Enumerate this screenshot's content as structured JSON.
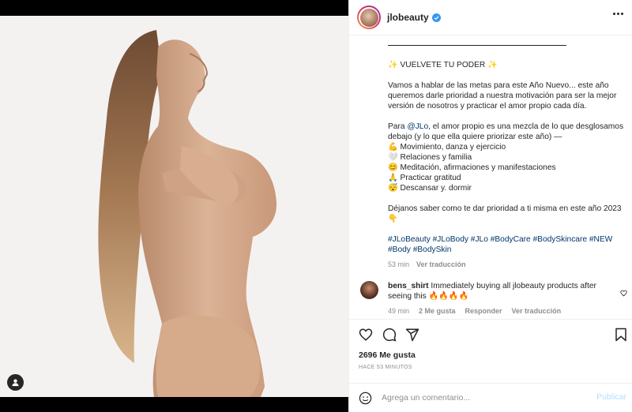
{
  "post": {
    "username": "jlobeauty",
    "image_alt": ""
  },
  "caption": {
    "title": "✨ VUELVETE TU PODER ✨",
    "para1": "Vamos a hablar de las metas para este Año Nuevo... este año queremos darle prioridad a nuestra motivación para ser la mejor versión de nosotros y practicar el amor propio cada día.",
    "para2_prefix": "Para ",
    "para2_mention": "@JLo",
    "para2_rest": ", el amor propio es una mezcla de lo que desglosamos debajo (y lo que ella quiere priorizar este año) —",
    "list": [
      {
        "emoji": "💪",
        "text": "Movimiento, danza y ejercicio"
      },
      {
        "emoji": "🤍",
        "text": "Relaciones y familia"
      },
      {
        "emoji": "😊",
        "text": "Meditación, afirmaciones y manifestaciones"
      },
      {
        "emoji": "🙏",
        "text": "Practicar gratitud"
      },
      {
        "emoji": "😴",
        "text": "Descansar y. dormir"
      }
    ],
    "para3": "Déjanos saber como te dar prioridad a ti misma en este año 2023 👇",
    "hashtags_line1": "#JLoBeauty #JLoBody #JLo #BodyCare #BodySkincare #NEW",
    "hashtags_line2": "#Body #BodySkin",
    "time": "53 min",
    "translate": "Ver traducción"
  },
  "comment": {
    "username": "bens_shirt",
    "text": "Immediately buying all jlobeauty products after seeing this 🔥🔥🔥🔥",
    "time": "49 min",
    "likes": "2 Me gusta",
    "reply": "Responder",
    "translate": "Ver traducción"
  },
  "stats": {
    "likes": "2696 Me gusta",
    "ago": "HACE 53 MINUTOS"
  },
  "add_comment": {
    "placeholder": "Agrega un comentario...",
    "publish": "Publicar"
  },
  "colors": {
    "link": "#00376b",
    "muted": "#8e8e8e",
    "verified": "#3897f0",
    "publish_disabled": "#b2dffc"
  }
}
